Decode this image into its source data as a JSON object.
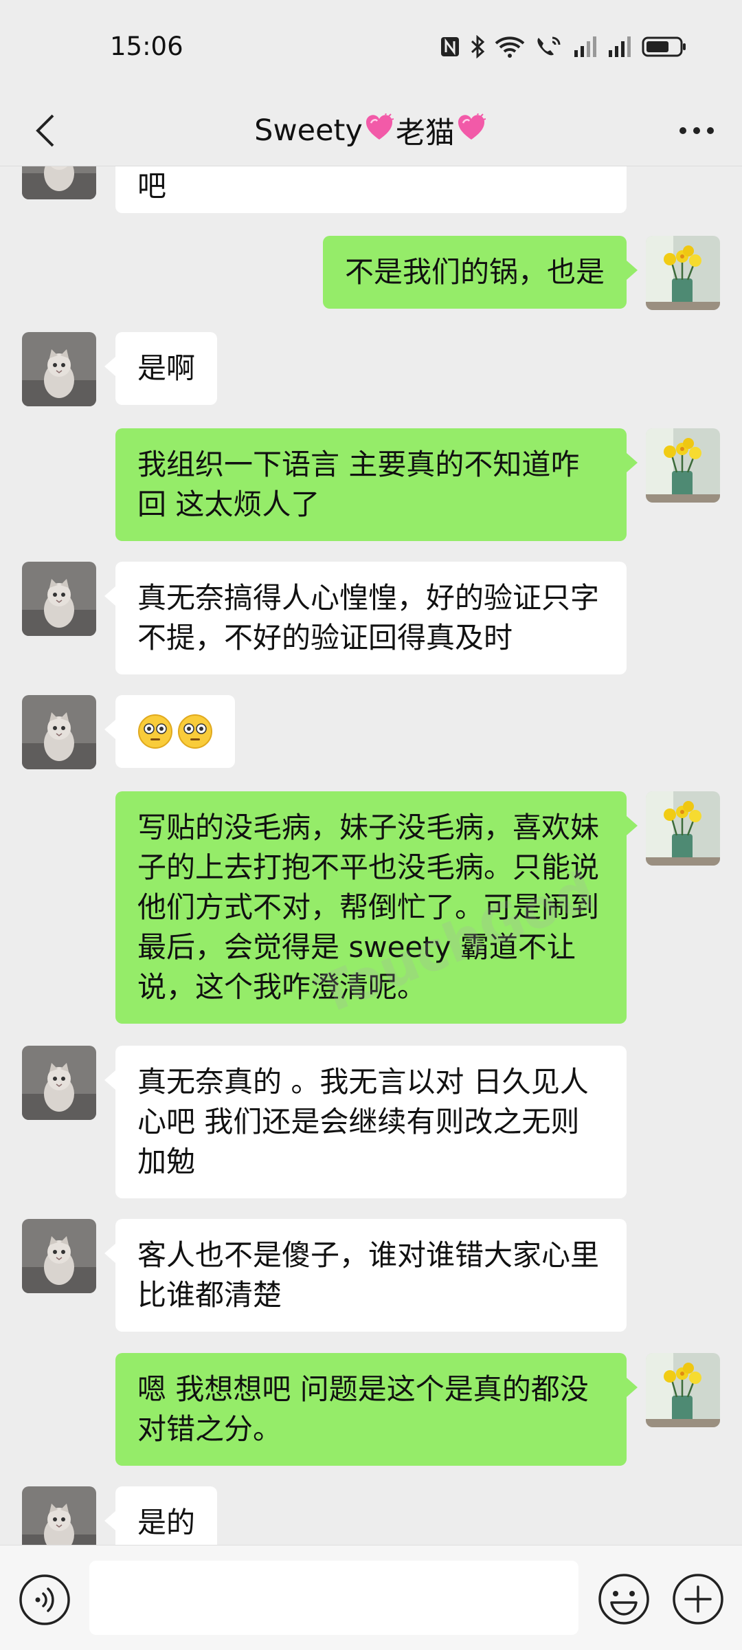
{
  "status_bar": {
    "time": "15:06"
  },
  "header": {
    "title_name": "Sweety",
    "title_suffix": "老猫"
  },
  "messages": [
    {
      "side": "in",
      "text": "吧"
    },
    {
      "side": "out",
      "text": "不是我们的锅，也是"
    },
    {
      "side": "in",
      "text": "是啊"
    },
    {
      "side": "out",
      "text": "我组织一下语言 主要真的不知道咋回 这太烦人了"
    },
    {
      "side": "in",
      "text": "真无奈搞得人心惶惶，好的验证只字不提，不好的验证回得真及时"
    },
    {
      "side": "in",
      "text": "",
      "emojis": [
        "flushed-emoji",
        "flushed-emoji"
      ]
    },
    {
      "side": "out",
      "text": "写贴的没毛病，妹子没毛病，喜欢妹子的上去打抱不平也没毛病。只能说他们方式不对，帮倒忙了。可是闹到最后，会觉得是 sweety 霸道不让说，这个我咋澄清呢。"
    },
    {
      "side": "in",
      "text": "真无奈真的 。我无言以对 日久见人心吧 我们还是会继续有则改之无则加勉"
    },
    {
      "side": "in",
      "text": "客人也不是傻子，谁对谁错大家心里比谁都清楚"
    },
    {
      "side": "out",
      "text": "嗯 我想想吧 问题是这个是真的都没对错之分。"
    },
    {
      "side": "in",
      "text": "是的"
    }
  ],
  "watermark": "TouchGod",
  "colors": {
    "out_bubble": "#95ec69",
    "in_bubble": "#ffffff",
    "background": "#ededed"
  },
  "icons": [
    "back-arrow-icon",
    "more-icon",
    "voice-icon",
    "emoji-icon",
    "plus-icon",
    "cat-avatar",
    "flowers-avatar"
  ]
}
